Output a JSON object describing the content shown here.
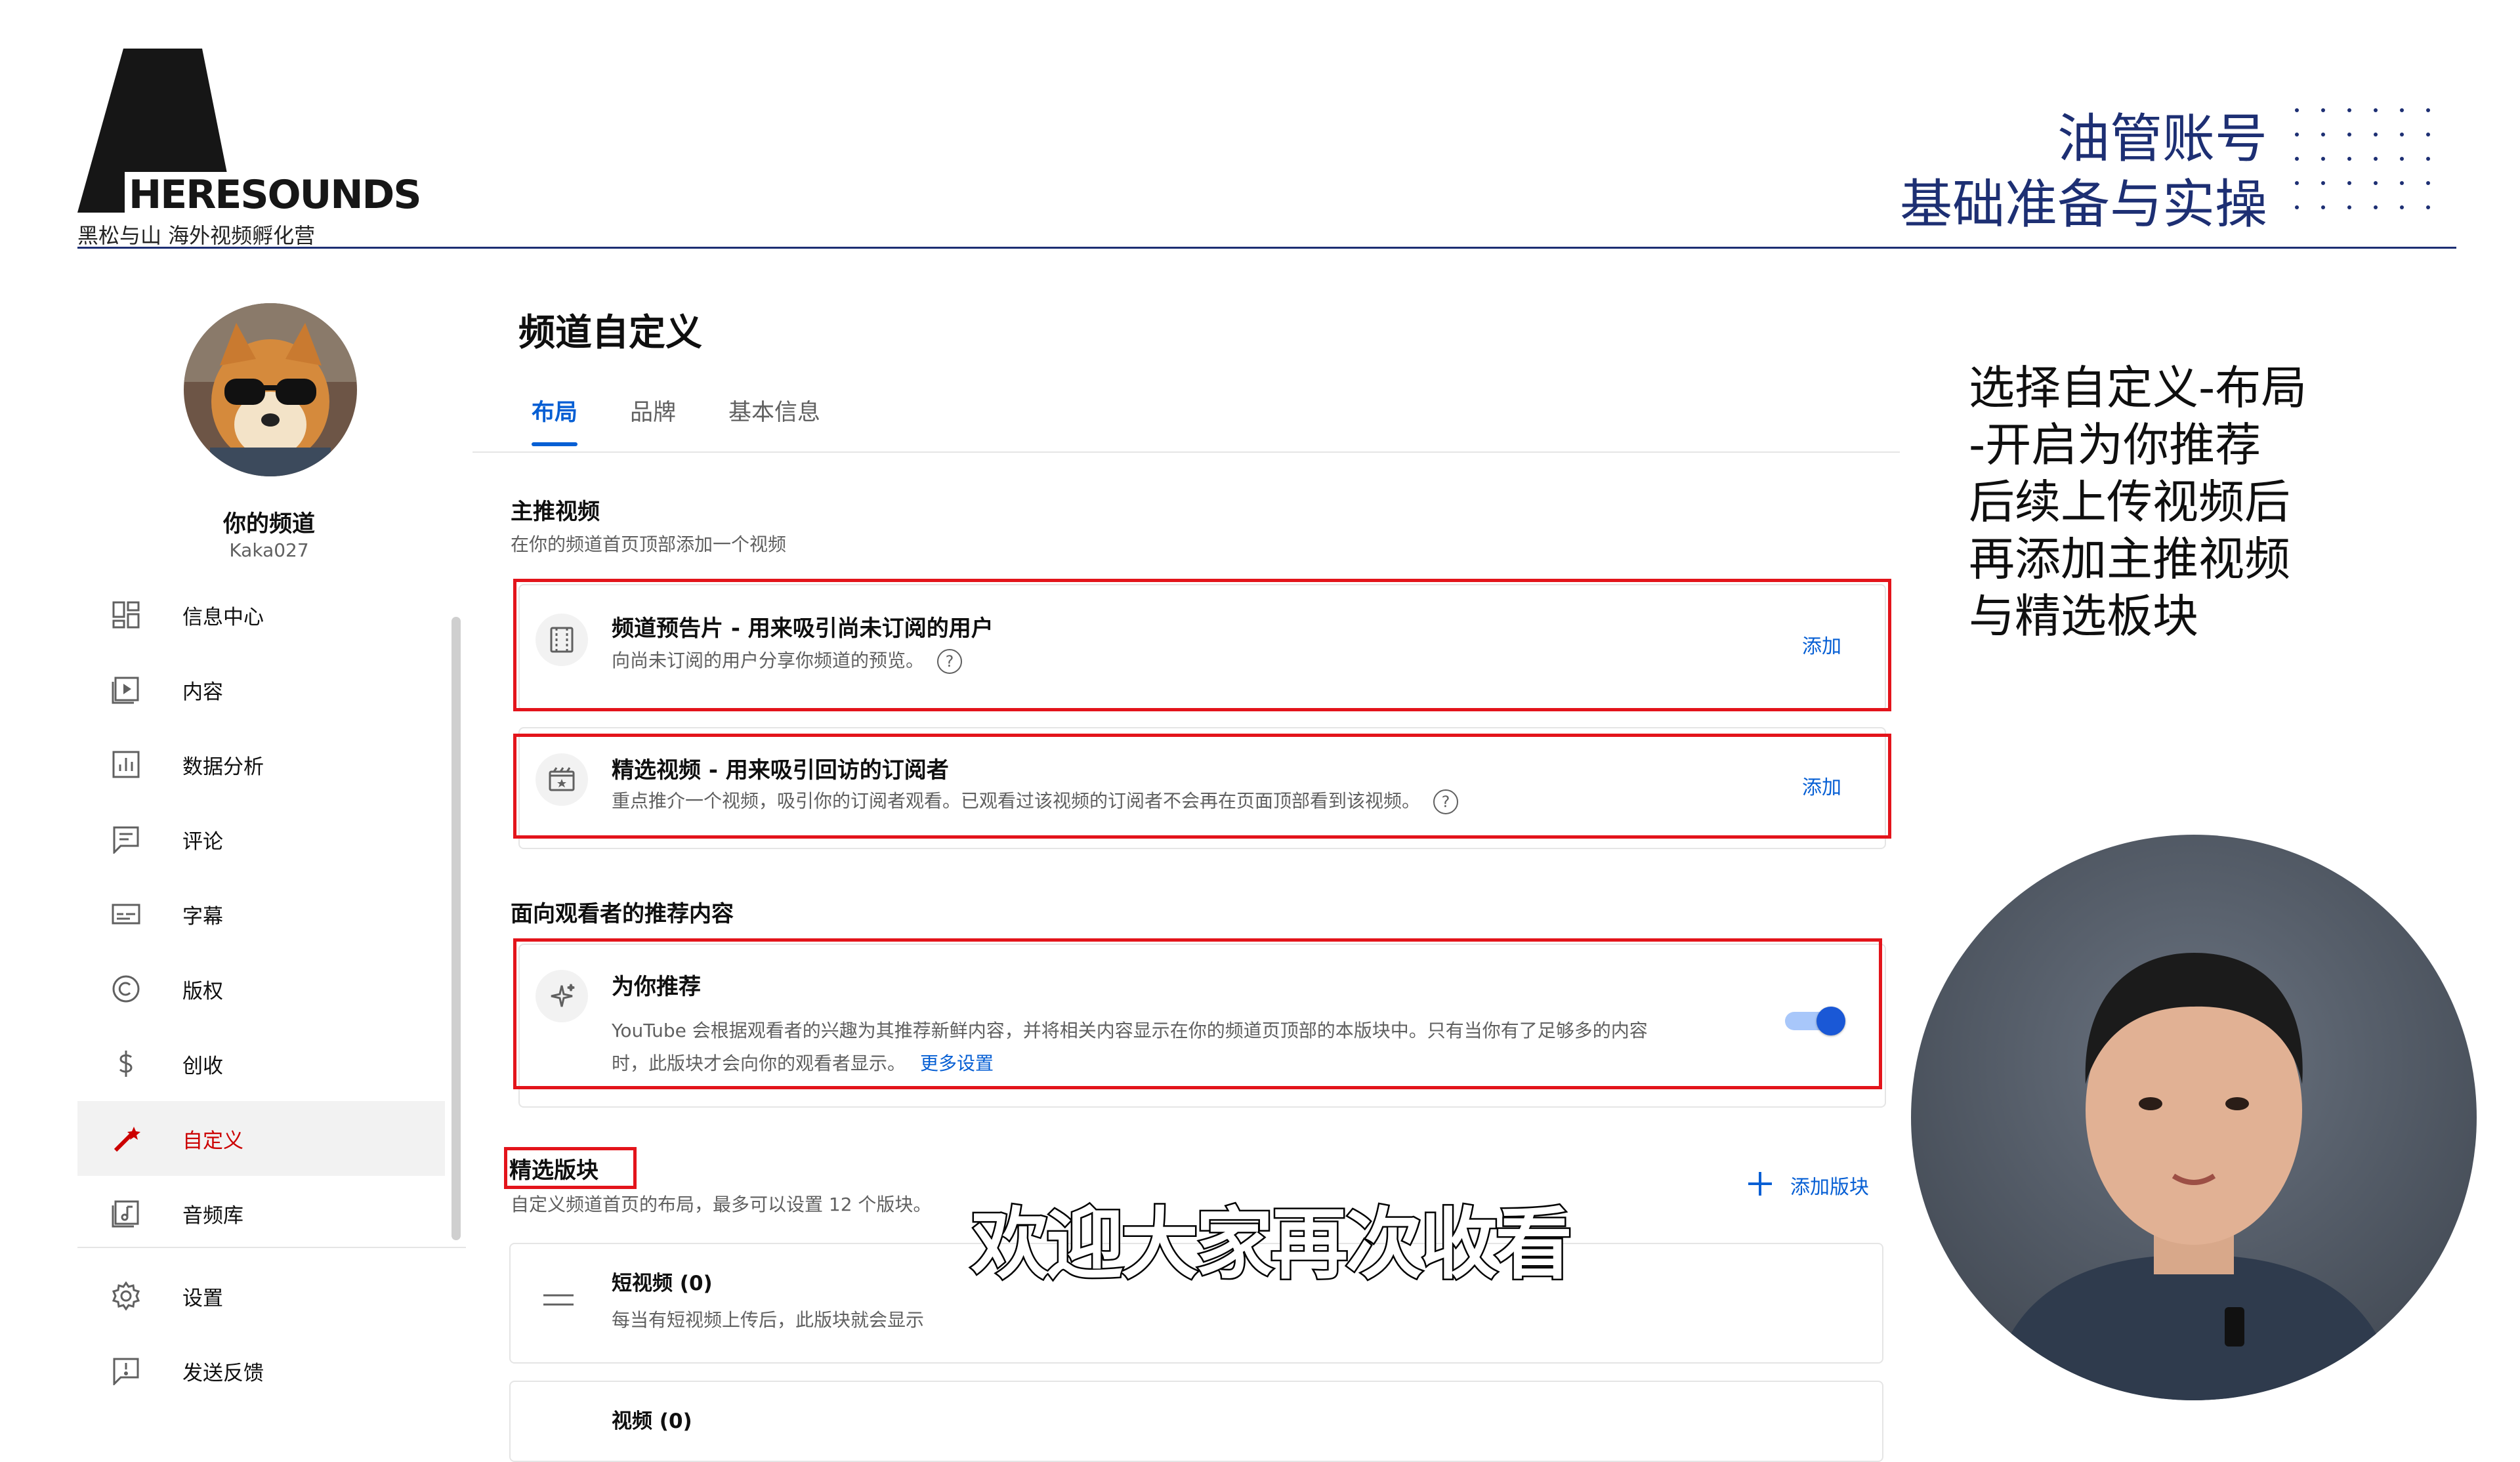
{
  "brand": {
    "wordmark": "HERESOUNDS",
    "tagline": "黑松与山 海外视频孵化营"
  },
  "slide_title": "油管账号\n基础准备与实操",
  "sidebar": {
    "channel_name": "你的频道",
    "channel_handle": "Kaka027",
    "items": [
      {
        "label": "信息中心",
        "icon": "dashboard-icon"
      },
      {
        "label": "内容",
        "icon": "content-icon"
      },
      {
        "label": "数据分析",
        "icon": "analytics-icon"
      },
      {
        "label": "评论",
        "icon": "comments-icon"
      },
      {
        "label": "字幕",
        "icon": "subtitles-icon"
      },
      {
        "label": "版权",
        "icon": "copyright-icon"
      },
      {
        "label": "创收",
        "icon": "monetization-icon"
      },
      {
        "label": "自定义",
        "icon": "customization-icon",
        "active": true
      },
      {
        "label": "音频库",
        "icon": "audio-library-icon"
      }
    ],
    "bottom_items": [
      {
        "label": "设置",
        "icon": "settings-icon"
      },
      {
        "label": "发送反馈",
        "icon": "feedback-icon"
      }
    ]
  },
  "main": {
    "title": "频道自定义",
    "tabs": [
      "布局",
      "品牌",
      "基本信息"
    ],
    "active_tab": "布局",
    "featured_video": {
      "title": "主推视频",
      "subtitle": "在你的频道首页顶部添加一个视频",
      "cards": [
        {
          "title": "频道预告片 - 用来吸引尚未订阅的用户",
          "desc": "向尚未订阅的用户分享你频道的预览。",
          "action": "添加"
        },
        {
          "title": "精选视频 - 用来吸引回访的订阅者",
          "desc": "重点推介一个视频，吸引你的订阅者观看。已观看过该视频的订阅者不会再在页面顶部看到该视频。",
          "action": "添加"
        }
      ]
    },
    "recommendations": {
      "title": "面向观看者的推荐内容",
      "card_title": "为你推荐",
      "card_desc_line1": "YouTube 会根据观看者的兴趣为其推荐新鲜内容，并将相关内容显示在你的频道页顶部的本版块中。只有当你有了足够多的内容",
      "card_desc_line2": "时，此版块才会向你的观看者显示。",
      "more_link": "更多设置",
      "enabled": true
    },
    "sections": {
      "title": "精选版块",
      "subtitle": "自定义频道首页的布局，最多可以设置 12 个版块。",
      "add_label": "添加版块",
      "items": [
        {
          "title": "短视频 (0)",
          "desc": "每当有短视频上传后，此版块就会显示"
        },
        {
          "title": "视频 (0)",
          "desc": ""
        }
      ]
    }
  },
  "side_note": "选择自定义-布局\n-开启为你推荐\n后续上传视频后\n再添加主推视频\n与精选板块",
  "caption": "欢迎大家再次收看",
  "colors": {
    "brand_navy": "#1d2f73",
    "yt_blue": "#065fd4",
    "highlight_red": "#e3141b",
    "active_red": "#cc0000"
  }
}
